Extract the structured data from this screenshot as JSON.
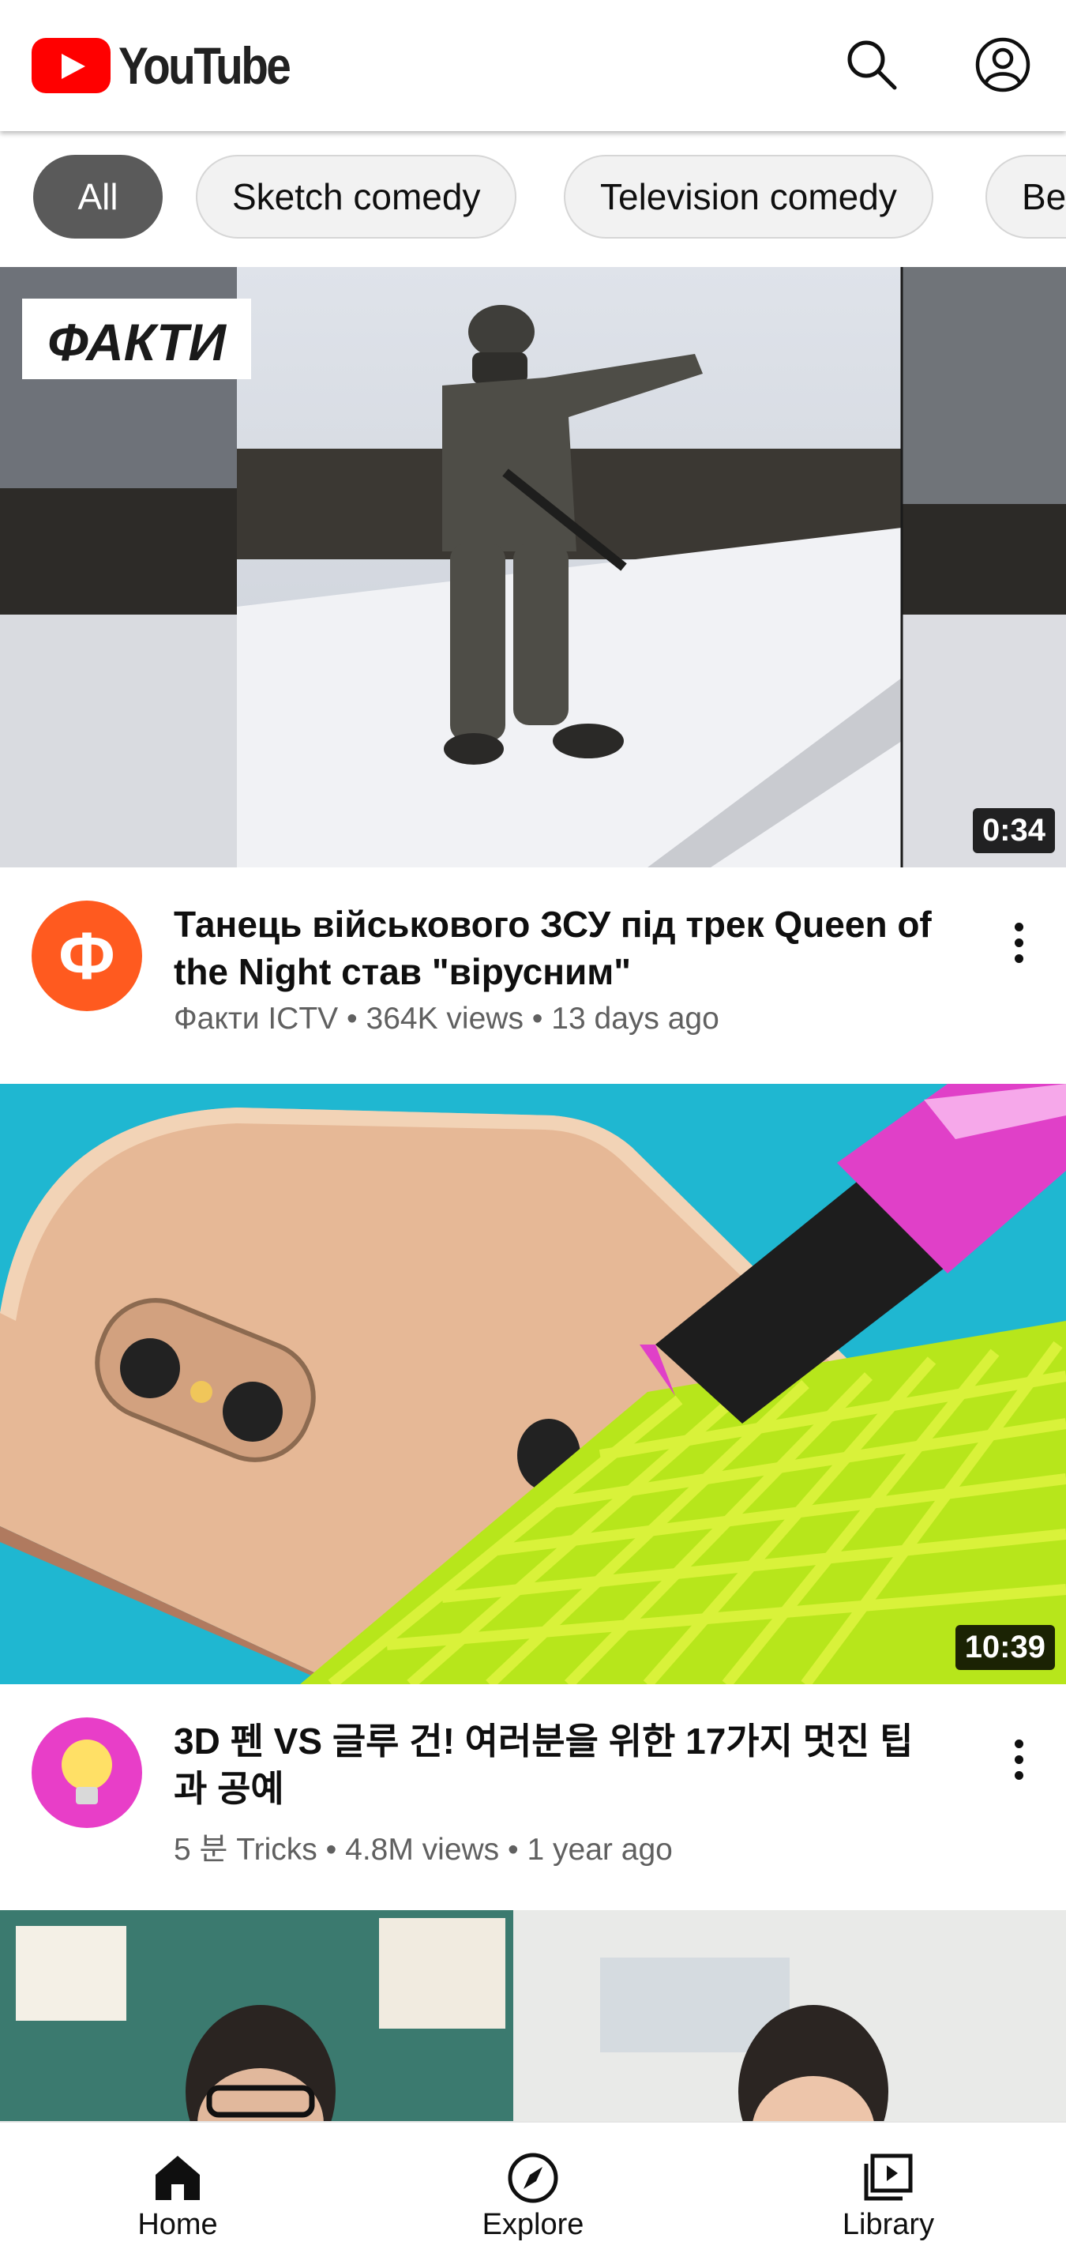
{
  "app": {
    "logo_text": "YouTube",
    "brand_color": "#ff0000"
  },
  "header": {
    "icons": [
      "search-icon",
      "account-icon"
    ]
  },
  "chips": [
    {
      "label": "All",
      "active": true
    },
    {
      "label": "Sketch comedy",
      "active": false
    },
    {
      "label": "Television comedy",
      "active": false
    },
    {
      "label": "Be",
      "active": false
    }
  ],
  "videos": [
    {
      "overlay_text": "ФАКТИ",
      "duration": "0:34",
      "title": "Танець військового ЗСУ під трек Queen of the Night став \"вірусним\"",
      "channel": "Факти ICTV",
      "views": "364K views",
      "age": "13 days ago",
      "avatar_letter": "Ф",
      "avatar_color": "#ff5a1f"
    },
    {
      "duration": "10:39",
      "title": "3D 펜 VS 글루 건! 여러분을 위한 17가지 멋진 팁 과 공예",
      "channel": "5 분 Tricks",
      "views": "4.8M views",
      "age": "1 year ago",
      "avatar_color": "#e83ec8"
    }
  ],
  "separator": "•",
  "bottom_nav": [
    {
      "label": "Home",
      "icon": "home-icon"
    },
    {
      "label": "Explore",
      "icon": "compass-icon"
    },
    {
      "label": "Library",
      "icon": "library-icon"
    }
  ]
}
